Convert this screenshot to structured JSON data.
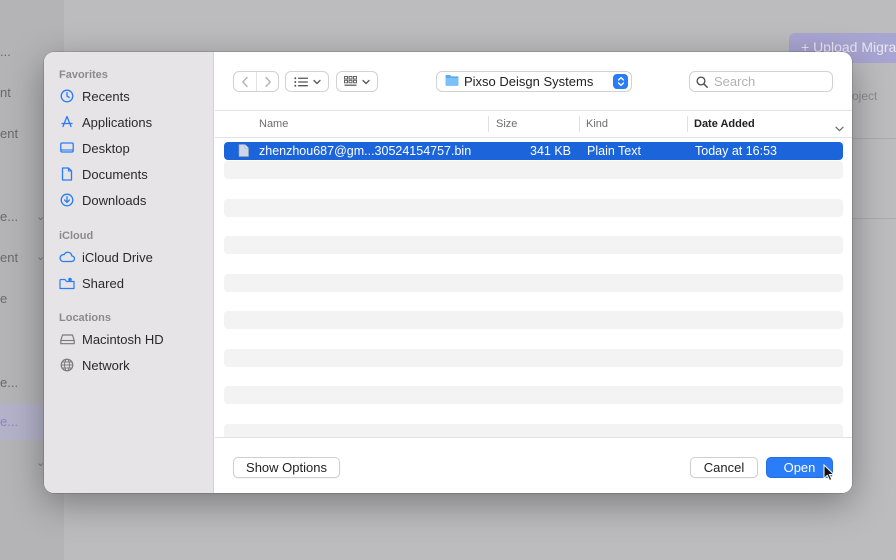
{
  "background_app": {
    "sidebar_fragments": [
      "...",
      "nt",
      "ent",
      "e...",
      "ent",
      "e",
      "e...",
      "e..."
    ],
    "upload_button": "+ Upload Migra",
    "column_fragment": "oject"
  },
  "dialog": {
    "sidebar": {
      "favorites_heading": "Favorites",
      "favorites": [
        {
          "label": "Recents",
          "icon": "clock-icon"
        },
        {
          "label": "Applications",
          "icon": "applications-icon"
        },
        {
          "label": "Desktop",
          "icon": "desktop-icon"
        },
        {
          "label": "Documents",
          "icon": "document-icon"
        },
        {
          "label": "Downloads",
          "icon": "download-icon"
        }
      ],
      "icloud_heading": "iCloud",
      "icloud": [
        {
          "label": "iCloud Drive",
          "icon": "cloud-icon"
        },
        {
          "label": "Shared",
          "icon": "shared-folder-icon"
        }
      ],
      "locations_heading": "Locations",
      "locations": [
        {
          "label": "Macintosh HD",
          "icon": "disk-icon"
        },
        {
          "label": "Network",
          "icon": "globe-icon"
        }
      ]
    },
    "toolbar": {
      "current_folder": "Pixso Deisgn Systems",
      "search_placeholder": "Search"
    },
    "columns": {
      "name": "Name",
      "size": "Size",
      "kind": "Kind",
      "date_added": "Date Added"
    },
    "files": [
      {
        "name": "zhenzhou687@gm...30524154757.bin",
        "size": "341 KB",
        "kind": "Plain Text",
        "date_added": "Today at 16:53",
        "selected": true
      }
    ],
    "footer": {
      "show_options": "Show Options",
      "cancel": "Cancel",
      "open": "Open"
    }
  },
  "colors": {
    "accent": "#2b7cf7",
    "selection": "#1c64da",
    "sidebar_icon": "#2a7cf6"
  }
}
